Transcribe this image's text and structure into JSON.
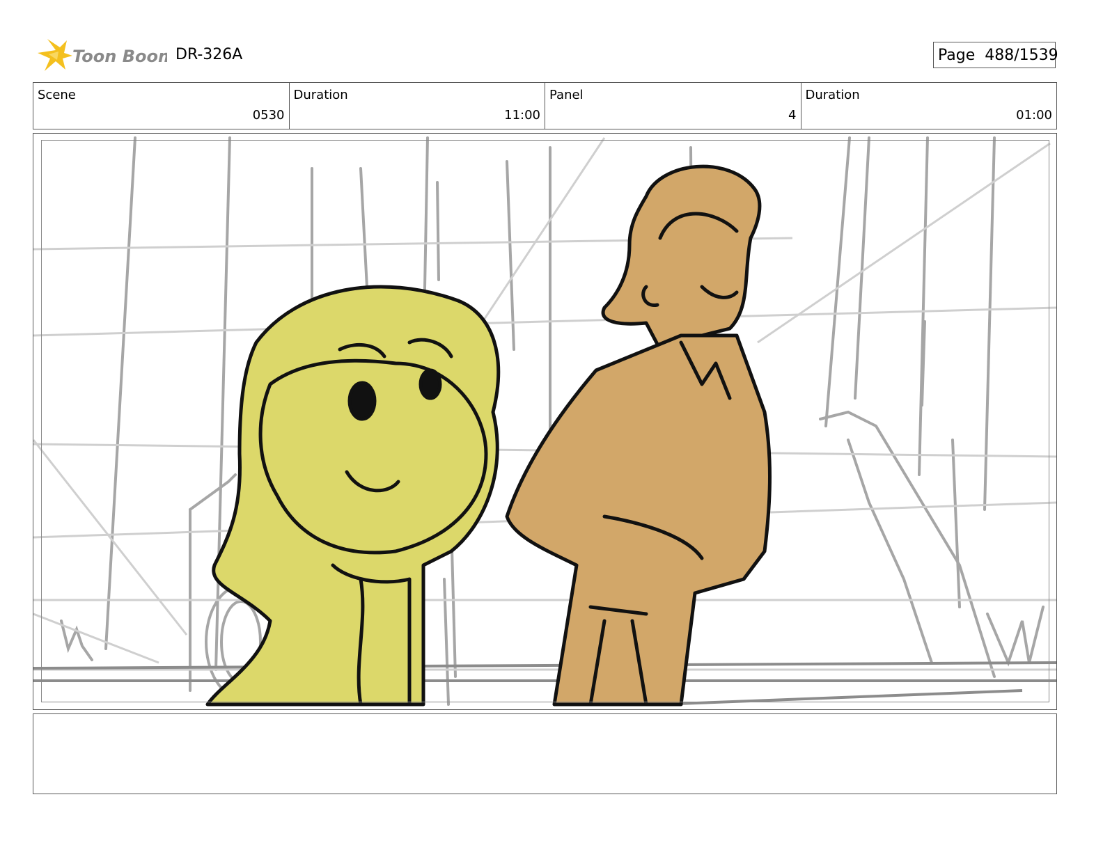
{
  "header": {
    "logo_text": "Toon Boom",
    "doc_id": "DR-326A",
    "page_label": "Page",
    "page_number": "488/1539"
  },
  "info": {
    "scene_label": "Scene",
    "scene_value": "0530",
    "scene_duration_label": "Duration",
    "scene_duration_value": "11:00",
    "panel_label": "Panel",
    "panel_value": "4",
    "panel_duration_label": "Duration",
    "panel_duration_value": "01:00"
  },
  "colors": {
    "girl_fill": "#dcd86a",
    "man_fill": "#d2a769",
    "sketch_gray": "#9a9a9a",
    "logo_star": "#f4c01e"
  },
  "notes_text": ""
}
